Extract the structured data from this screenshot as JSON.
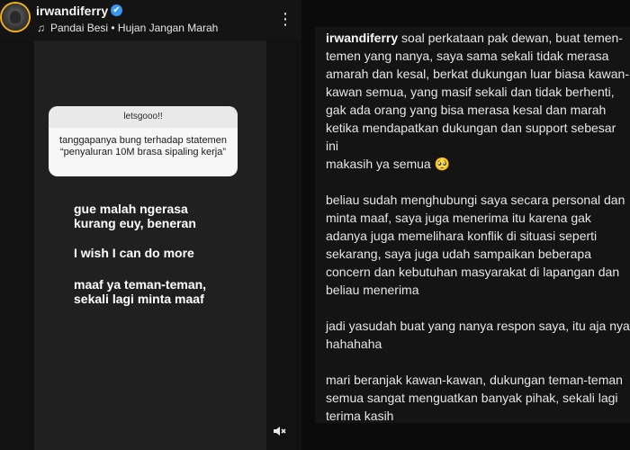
{
  "header": {
    "username": "irwandiferry",
    "song": "Pandai Besi • Hujan Jangan Marah",
    "verified_color": "#3897f0",
    "avatar_ring_color": "#f3b21a"
  },
  "question_box": {
    "header": "letsgooo!!",
    "question": "tanggapanya bung terhadap statemen “penyaluran 10M brasa sipaling kerja”"
  },
  "answers": [
    "gue malah ngerasa\nkurang euy, beneran",
    "I wish I can do more",
    "maaf ya teman-teman,\nsekali lagi minta maaf"
  ],
  "caption": {
    "username": "irwandiferry",
    "para1_rest": " soal perkataan pak dewan, buat temen-temen yang nanya, saya sama sekali tidak merasa amarah dan kesal, berkat dukungan luar biasa kawan-kawan semua, yang masif sekali dan tidak berhenti, gak ada orang yang bisa merasa kesal dan marah ketika mendapatkan dukungan dan support sebesar ini\nmakasih ya semua 🥺",
    "para2": "beliau sudah menghubungi saya secara personal dan minta maaf, saya juga menerima itu karena gak adanya juga memelihara konflik di situasi seperti sekarang, saya juga udah sampaikan beberapa concern dan kebutuhan masyarakat di lapangan dan beliau menerima",
    "para3": "jadi yasudah buat yang nanya respon saya, itu aja nya hahahaha",
    "para4": "mari beranjak kawan-kawan, dukungan teman-teman semua sangat menguatkan banyak pihak, sekali lagi terima kasih"
  },
  "icons": {
    "verified": "verified-badge-icon",
    "music": "music-note-icon",
    "more": "more-vertical-icon",
    "mute": "mute-speaker-icon"
  }
}
